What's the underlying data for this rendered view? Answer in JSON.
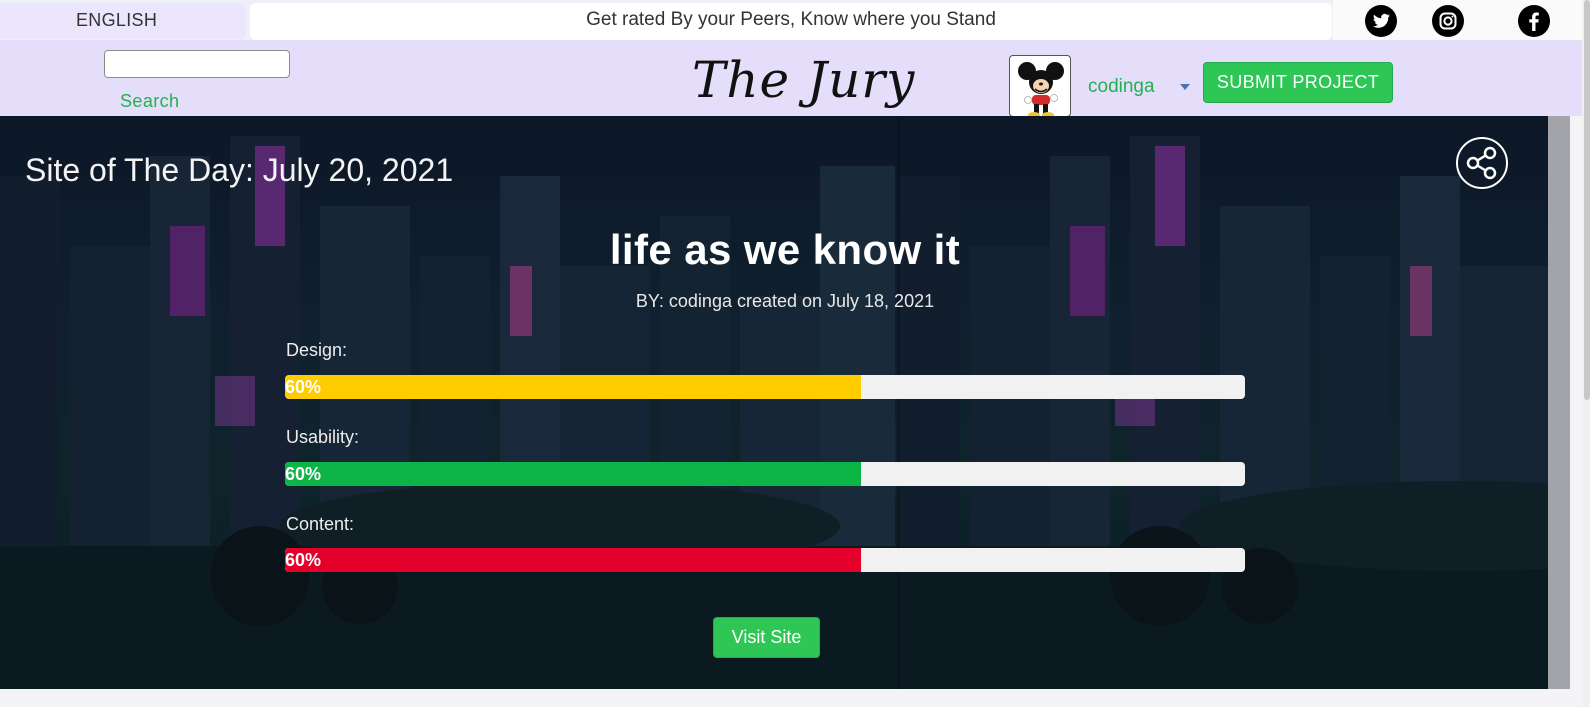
{
  "topbar": {
    "language": "ENGLISH",
    "tagline": "Get rated By your Peers, Know where you Stand",
    "social_icons": [
      "twitter-icon",
      "instagram-icon",
      "facebook-icon"
    ]
  },
  "header": {
    "search_placeholder": "",
    "search_label": "Search",
    "brand": "The Jury",
    "username": "codinga",
    "submit_label": "SUBMIT PROJECT"
  },
  "hero": {
    "heading": "Site of The Day: July 20, 2021",
    "site_title": "life as we know it",
    "byline": "BY: codinga created on July 18, 2021",
    "visit_label": "Visit Site",
    "metrics": [
      {
        "label": "Design:",
        "percent": 60,
        "percent_text": "60%",
        "color": "#ffcc00"
      },
      {
        "label": "Usability:",
        "percent": 60,
        "percent_text": "60%",
        "color": "#0db446"
      },
      {
        "label": "Content:",
        "percent": 60,
        "percent_text": "60%",
        "color": "#e4002b"
      }
    ]
  },
  "colors": {
    "accent_green": "#2ec654",
    "header_bg": "#e4defa",
    "link_green": "#23b14d"
  }
}
